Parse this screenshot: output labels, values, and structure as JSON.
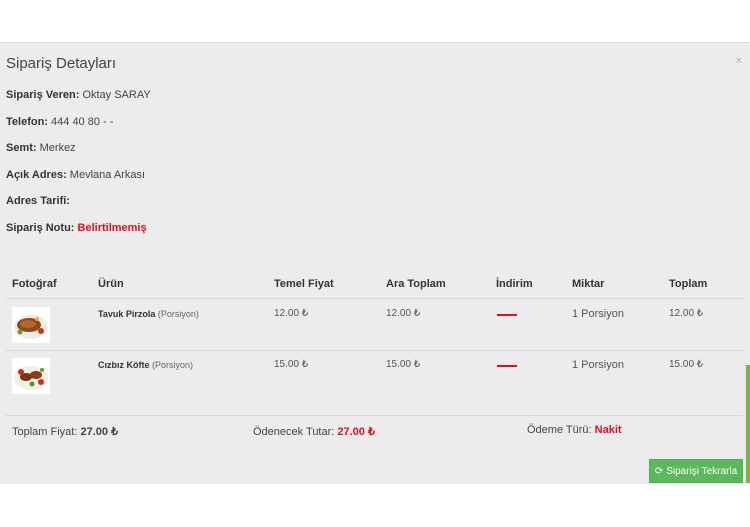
{
  "modal": {
    "title": "Sipariş Detayları",
    "close": "×"
  },
  "info": {
    "orderer_label": "Sipariş Veren:",
    "orderer_value": "Oktay SARAY",
    "phone_label": "Telefon:",
    "phone_value": "444 40 80 - -",
    "district_label": "Semt:",
    "district_value": "Merkez",
    "address_label": "Açık Adres:",
    "address_value": "Mevlana Arkası",
    "directions_label": "Adres Tarifi:",
    "note_label": "Sipariş Notu:",
    "note_value": "Belirtilmemiş"
  },
  "table": {
    "headers": [
      "Fotoğraf",
      "Ürün",
      "Temel Fiyat",
      "Ara Toplam",
      "İndirim",
      "Miktar",
      "Toplam"
    ],
    "rows": [
      {
        "name": "Tavuk Pirzola",
        "unit": "(Porsiyon)",
        "base_price": "12.00 ₺",
        "subtotal": "12.00 ₺",
        "quantity": "1 Porsiyon",
        "total": "12.00 ₺"
      },
      {
        "name": "Cızbız Köfte",
        "unit": "(Porsiyon)",
        "base_price": "15.00 ₺",
        "subtotal": "15.00 ₺",
        "quantity": "1 Porsiyon",
        "total": "15.00 ₺"
      }
    ]
  },
  "footer": {
    "total_label": "Toplam Fiyat:",
    "total_value": "27.00 ₺",
    "payable_label": "Ödenecek Tutar:",
    "payable_value": "27.00 ₺",
    "payment_label": "Ödeme Türü:",
    "payment_value": "Nakit",
    "reorder_button": "Siparişi Tekrarla",
    "reorder_icon": "refresh-icon"
  },
  "colors": {
    "accent_red": "#e0101f",
    "button_green": "#5cb85c",
    "background": "#ececec"
  }
}
